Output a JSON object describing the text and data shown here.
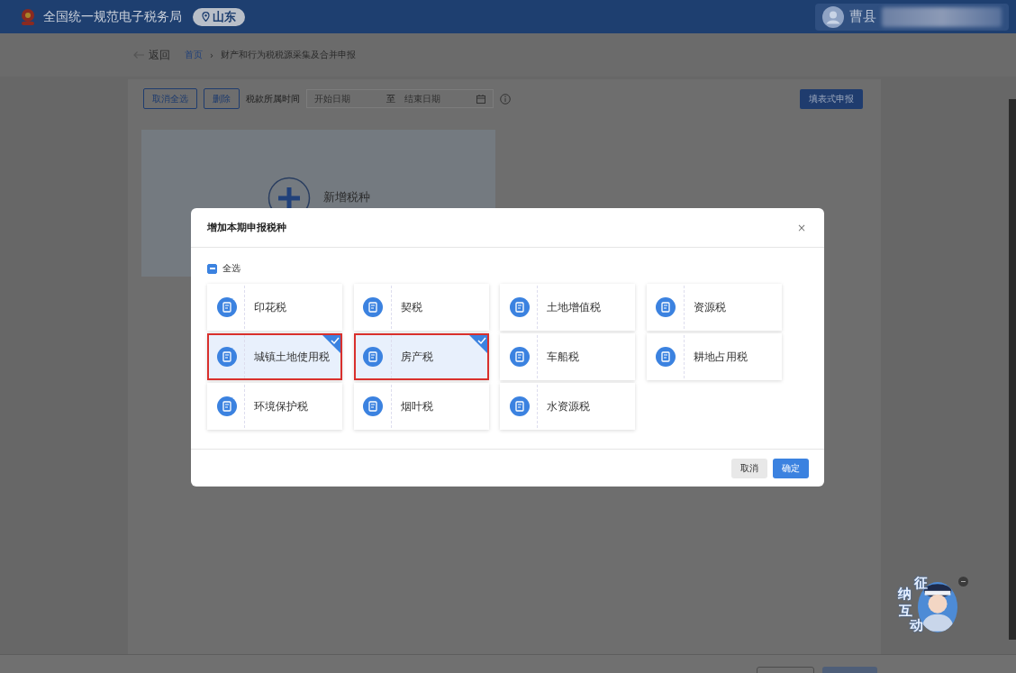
{
  "header": {
    "title": "全国统一规范电子税务局",
    "region": "山东",
    "user": "曹县"
  },
  "breadcrumb": {
    "back": "返回",
    "home": "首页",
    "separator": "›",
    "current": "财产和行为税税源采集及合并申报"
  },
  "toolbar": {
    "deselect_all": "取消全选",
    "delete": "删除",
    "period_label": "税款所属时间",
    "start_placeholder": "开始日期",
    "range_separator": "至",
    "end_placeholder": "结束日期",
    "submit": "填表式申报"
  },
  "add_card": {
    "label": "新增税种"
  },
  "dialog": {
    "title": "增加本期申报税种",
    "close": "×",
    "select_all": {
      "label": "全选",
      "indeterminate": true
    },
    "taxes": [
      {
        "name": "印花税",
        "selected": false
      },
      {
        "name": "契税",
        "selected": false
      },
      {
        "name": "土地增值税",
        "selected": false
      },
      {
        "name": "资源税",
        "selected": false
      },
      {
        "name": "城镇土地使用税",
        "selected": true
      },
      {
        "name": "房产税",
        "selected": true
      },
      {
        "name": "车船税",
        "selected": false
      },
      {
        "name": "耕地占用税",
        "selected": false
      },
      {
        "name": "环境保护税",
        "selected": false
      },
      {
        "name": "烟叶税",
        "selected": false
      },
      {
        "name": "水资源税",
        "selected": false
      }
    ],
    "buttons": [
      {
        "label": "取消",
        "kind": "secondary"
      },
      {
        "label": "确定",
        "kind": "primary"
      }
    ]
  },
  "assistant": {
    "label": [
      "征",
      "纳",
      "互",
      "动"
    ]
  }
}
